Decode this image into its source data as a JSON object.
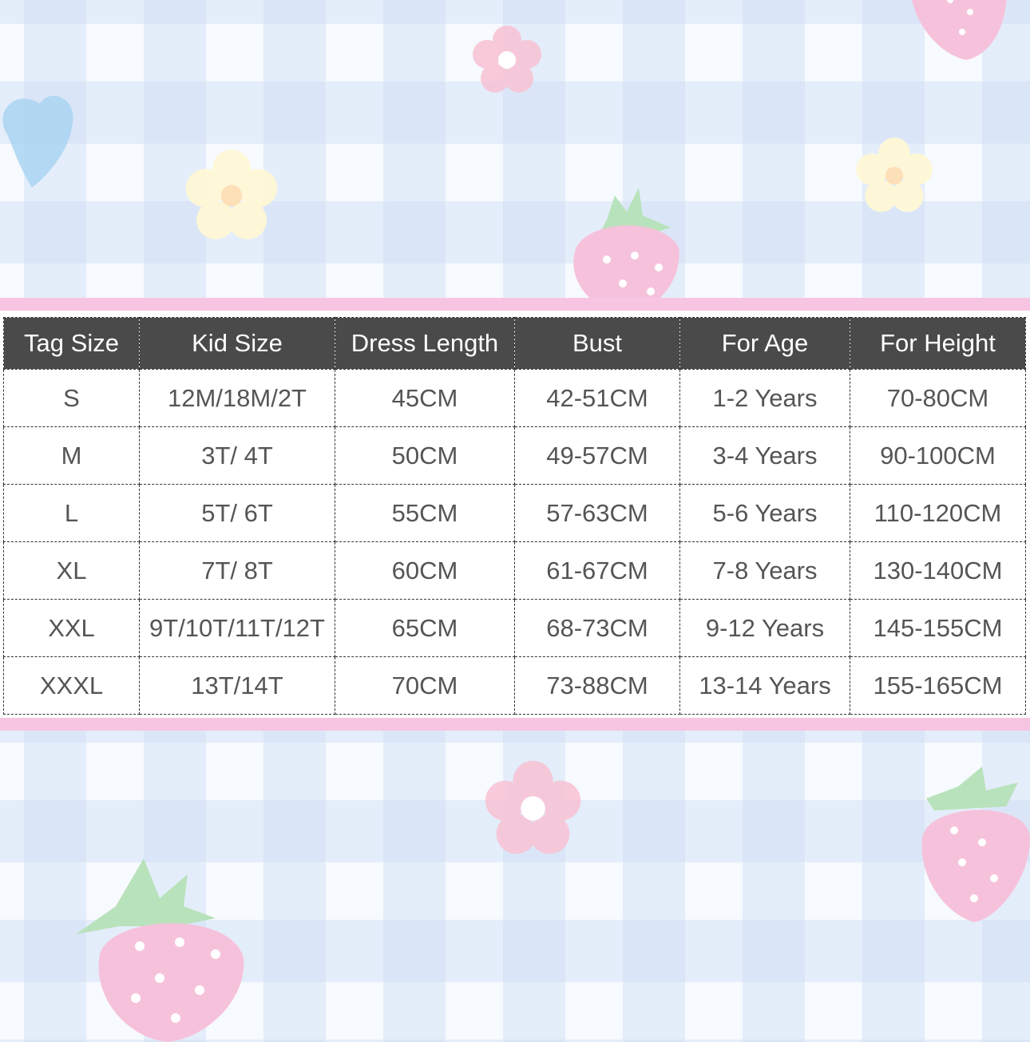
{
  "size_chart": {
    "headers": [
      "Tag Size",
      "Kid Size",
      "Dress Length",
      "Bust",
      "For Age",
      "For Height"
    ],
    "rows": [
      [
        "S",
        "12M/18M/2T",
        "45CM",
        "42-51CM",
        "1-2 Years",
        "70-80CM"
      ],
      [
        "M",
        "3T/ 4T",
        "50CM",
        "49-57CM",
        "3-4 Years",
        "90-100CM"
      ],
      [
        "L",
        "5T/ 6T",
        "55CM",
        "57-63CM",
        "5-6 Years",
        "110-120CM"
      ],
      [
        "XL",
        "7T/ 8T",
        "60CM",
        "61-67CM",
        "7-8 Years",
        "130-140CM"
      ],
      [
        "XXL",
        "9T/10T/11T/12T",
        "65CM",
        "68-73CM",
        "9-12 Years",
        "145-155CM"
      ],
      [
        "XXXL",
        "13T/14T",
        "70CM",
        "73-88CM",
        "13-14 Years",
        "155-165CM"
      ]
    ]
  },
  "theme": {
    "band_pink": "#f7c5e1",
    "header_bg": "#4a4a4a",
    "strawberry": "#f6c2db",
    "leaf": "#b8e2bb",
    "heart": "#a9d4f2"
  },
  "decorations": [
    "strawberry-icon",
    "flower-icon",
    "heart-icon"
  ]
}
